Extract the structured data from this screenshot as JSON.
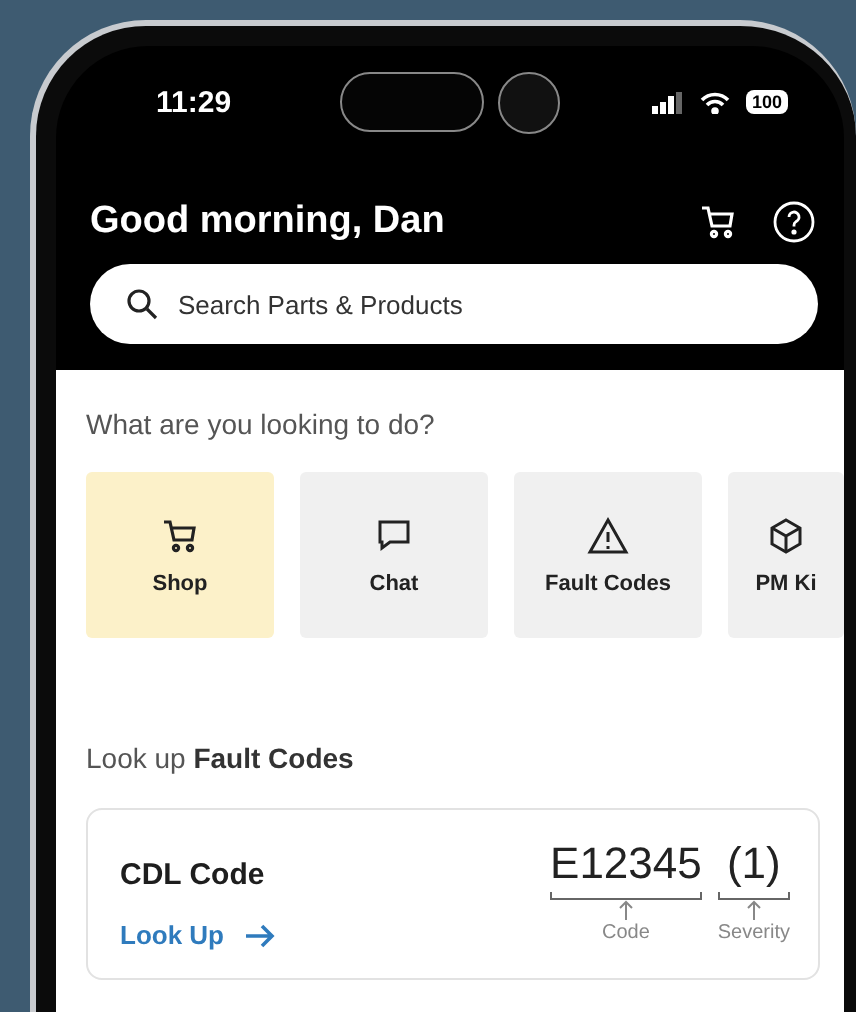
{
  "status_bar": {
    "time": "11:29",
    "battery": "100"
  },
  "header": {
    "greeting": "Good morning, Dan"
  },
  "search": {
    "placeholder": "Search Parts & Products"
  },
  "prompt": "What are you looking to do?",
  "actions": [
    {
      "kind": "cart",
      "label": "Shop",
      "selected": true
    },
    {
      "kind": "chat",
      "label": "Chat",
      "selected": false
    },
    {
      "kind": "warning",
      "label": "Fault Codes",
      "selected": false
    },
    {
      "kind": "box",
      "label": "PM Ki",
      "selected": false
    }
  ],
  "lookup": {
    "heading": "Look up **Fault Codes**",
    "card": {
      "title": "CDL Code",
      "link": "Look Up",
      "code": "E12345",
      "severity": "(1)",
      "code_caption": "Code",
      "severity_caption": "Severity"
    }
  }
}
